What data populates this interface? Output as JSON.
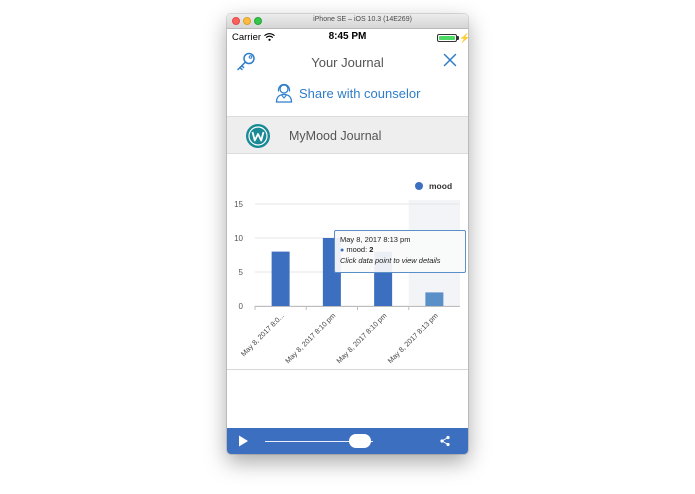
{
  "window": {
    "title": "iPhone SE – iOS 10.3 (14E269)"
  },
  "status_bar": {
    "carrier": "Carrier",
    "time": "8:45 PM",
    "battery_percent": 100
  },
  "nav": {
    "title": "Your Journal",
    "left_icon": "key-icon",
    "right_icon": "close-icon"
  },
  "share": {
    "label": "Share with counselor",
    "icon": "counselor-person-icon"
  },
  "journal": {
    "title": "MyMood Journal",
    "logo": "w-logo"
  },
  "colors": {
    "accent": "#2f7dc9",
    "bar": "#3d6fc1",
    "highlight_bar": "#5b8fc7",
    "media_bar": "#3d6fc1"
  },
  "chart_data": {
    "type": "bar",
    "categories": [
      "May 8, 2017 8:0...",
      "May 8, 2017 8:10 pm",
      "May 8, 2017 8:10 pm",
      "May 8, 2017 8:13 pm"
    ],
    "series": [
      {
        "name": "mood",
        "values": [
          8,
          10,
          8,
          2
        ]
      }
    ],
    "ylim": [
      0,
      15
    ],
    "yticks": [
      0,
      5,
      10,
      15
    ],
    "legend": "top-right",
    "grid": true,
    "highlighted_index": 3
  },
  "tooltip": {
    "date": "May 8, 2017 8:13 pm",
    "series_label": "mood: ",
    "value": "2",
    "hint": "Click data point to view details"
  },
  "media": {
    "progress": 0.88
  }
}
